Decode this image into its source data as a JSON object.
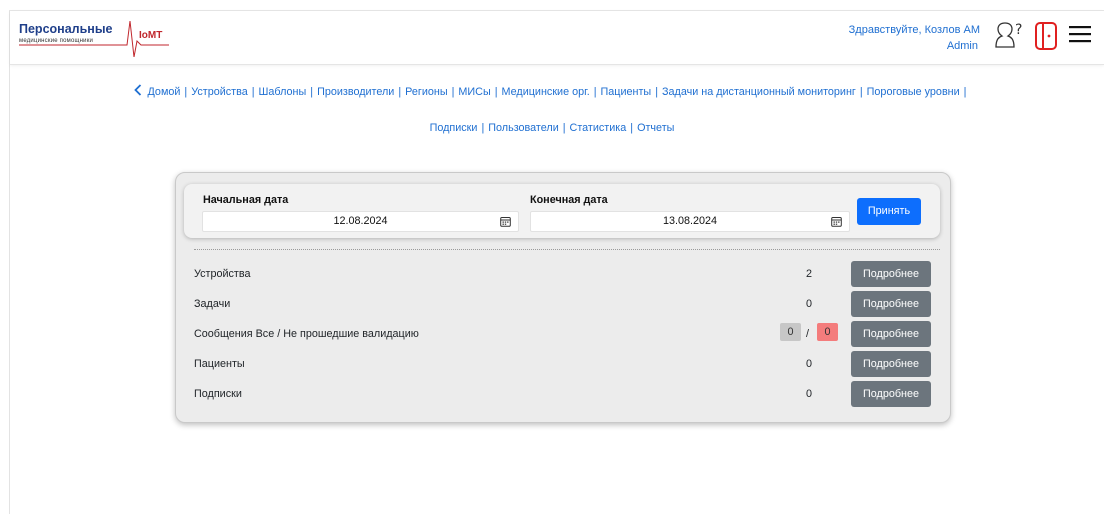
{
  "header": {
    "logo": {
      "title": "Персональные",
      "subtitle": "медицинские помощники",
      "brand": "IoMT"
    },
    "greeting": "Здравствуйте, Козлов АМ",
    "role": "Admin",
    "icons": [
      "help-icon",
      "exit-icon",
      "hamburger-menu-icon"
    ]
  },
  "nav": {
    "row1": [
      "Домой",
      "Устройства",
      "Шаблоны",
      "Производители",
      "Регионы",
      "МИСы",
      "Медицинские орг.",
      "Пациенты",
      "Задачи на дистанционный мониторинг",
      "Пороговые уровни"
    ],
    "row2": [
      "Подписки",
      "Пользователи",
      "Статистика",
      "Отчеты"
    ]
  },
  "filter": {
    "start_label": "Начальная дата",
    "start_value": "12.08.2024",
    "end_label": "Конечная дата",
    "end_value": "13.08.2024",
    "apply_label": "Принять"
  },
  "stats": {
    "rows": [
      {
        "name": "Устройства",
        "count": "2",
        "button": "Подробнее"
      },
      {
        "name": "Задачи",
        "count": "0",
        "button": "Подробнее"
      },
      {
        "name": "Сообщения Все / Не прошедшие валидацию",
        "all": "0",
        "slash": "/",
        "invalid": "0",
        "button": "Подробнее"
      },
      {
        "name": "Пациенты",
        "count": "0",
        "button": "Подробнее"
      },
      {
        "name": "Подписки",
        "count": "0",
        "button": "Подробнее"
      }
    ]
  },
  "colors": {
    "link": "#1f6fd1",
    "primary": "#0d6efd",
    "secondary": "#6c757d",
    "danger_badge": "#f47c7c",
    "neutral_badge": "#c7c7c7",
    "logo_red": "#c0262c"
  }
}
